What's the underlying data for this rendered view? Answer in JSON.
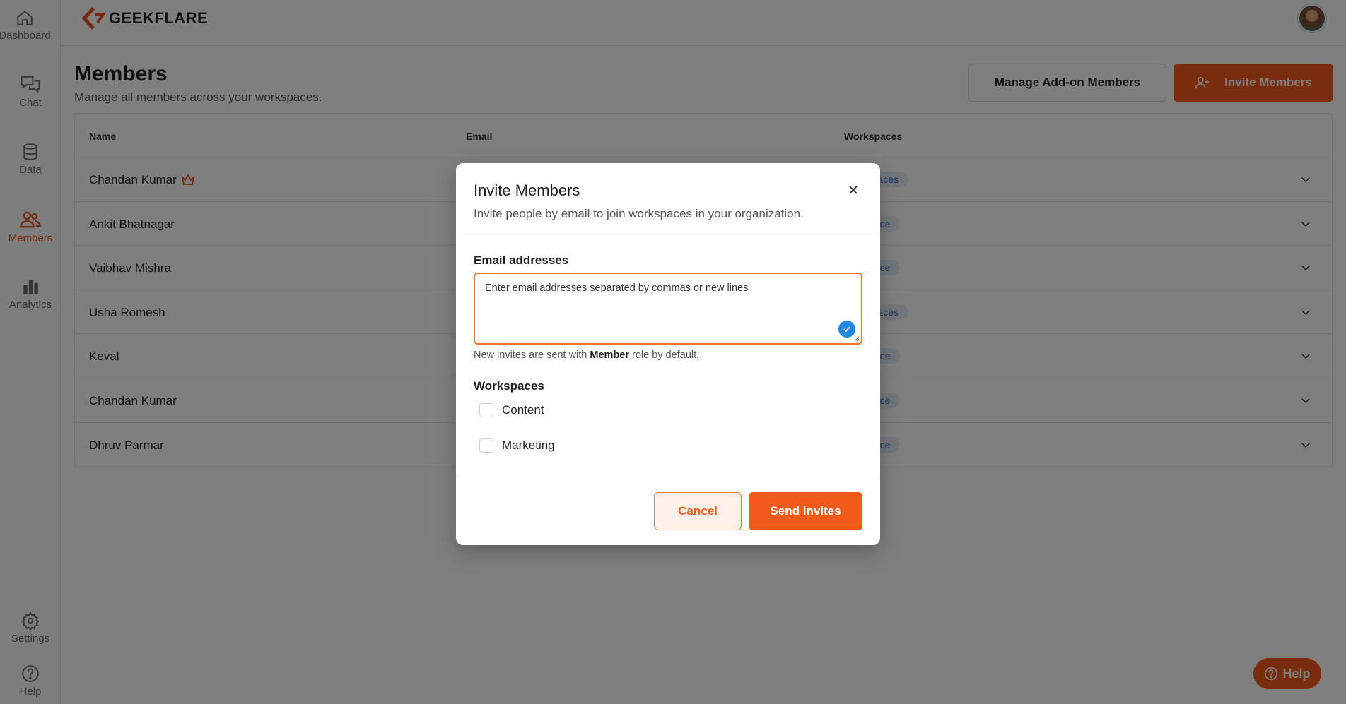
{
  "sidebar": {
    "items": [
      {
        "label": "Dashboard",
        "icon": "home-icon"
      },
      {
        "label": "Chat",
        "icon": "chat-icon"
      },
      {
        "label": "Data",
        "icon": "database-icon"
      },
      {
        "label": "Members",
        "icon": "users-icon",
        "active": true
      },
      {
        "label": "Analytics",
        "icon": "bar-chart-icon"
      },
      {
        "label": "Settings",
        "icon": "gear-icon"
      },
      {
        "label": "Help",
        "icon": "help-circle-icon"
      }
    ]
  },
  "topbar": {
    "logo_text": "GEEKFLARE"
  },
  "page": {
    "title": "Members",
    "subtitle": "Manage all members across your workspaces.",
    "manage_button": "Manage Add-on Members",
    "invite_button": "Invite Members"
  },
  "table": {
    "headers": {
      "name": "Name",
      "email": "Email",
      "workspaces": "Workspaces"
    },
    "rows": [
      {
        "name": "Chandan Kumar",
        "owner": true,
        "workspaces": "rkspaces"
      },
      {
        "name": "Ankit Bhatnagar",
        "workspaces": "kspace"
      },
      {
        "name": "Vaibhav Mishra",
        "workspaces": "kspace"
      },
      {
        "name": "Usha Romesh",
        "workspaces": "rkspaces"
      },
      {
        "name": "Keval",
        "workspaces": "kspace"
      },
      {
        "name": "Chandan Kumar",
        "workspaces": "kspace"
      },
      {
        "name": "Dhruv Parmar",
        "workspaces": "kspace"
      }
    ]
  },
  "help_button": "Help",
  "modal": {
    "title": "Invite Members",
    "subtitle": "Invite people by email to join workspaces in your organization.",
    "email_label": "Email addresses",
    "email_placeholder": "Enter email addresses separated by commas or new lines",
    "email_value": "",
    "hint_prefix": "New invites are sent with ",
    "hint_role": "Member",
    "hint_suffix": " role by default.",
    "workspaces_label": "Workspaces",
    "workspaces": [
      {
        "label": "Content",
        "checked": false
      },
      {
        "label": "Marketing",
        "checked": false
      }
    ],
    "cancel_label": "Cancel",
    "send_label": "Send invites"
  },
  "colors": {
    "accent": "#f25a1c",
    "badge_bg": "#e7eef7",
    "badge_text": "#2f6fc2",
    "check_badge": "#1e88e5"
  }
}
